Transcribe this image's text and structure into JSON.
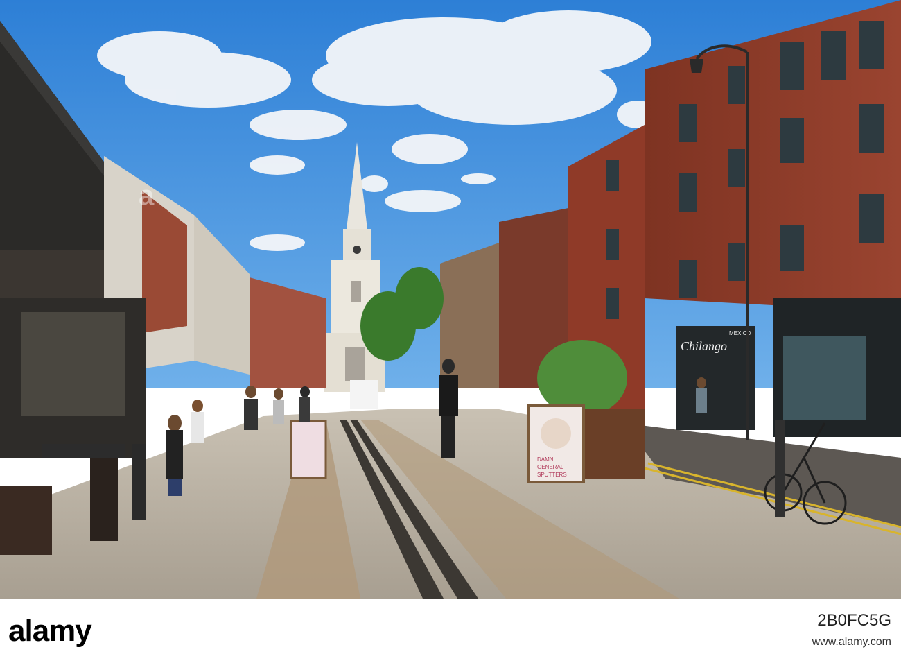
{
  "photo": {
    "description_colors": {
      "sky": "#3f8fde",
      "cloud": "#f4f6f9",
      "brick": "#8d3b2a",
      "pavement": "#bdb3a4",
      "spire": "#e8e6df"
    },
    "signs": {
      "chilango": "Chilango",
      "mexico": "MEXICO",
      "board_text_1": "DAMN",
      "board_text_2": "GENERAL",
      "board_text_3": "SPUTTERS"
    }
  },
  "footer": {
    "logo_text": "alamy",
    "image_id": "2B0FC5G",
    "site_url": "www.alamy.com"
  }
}
